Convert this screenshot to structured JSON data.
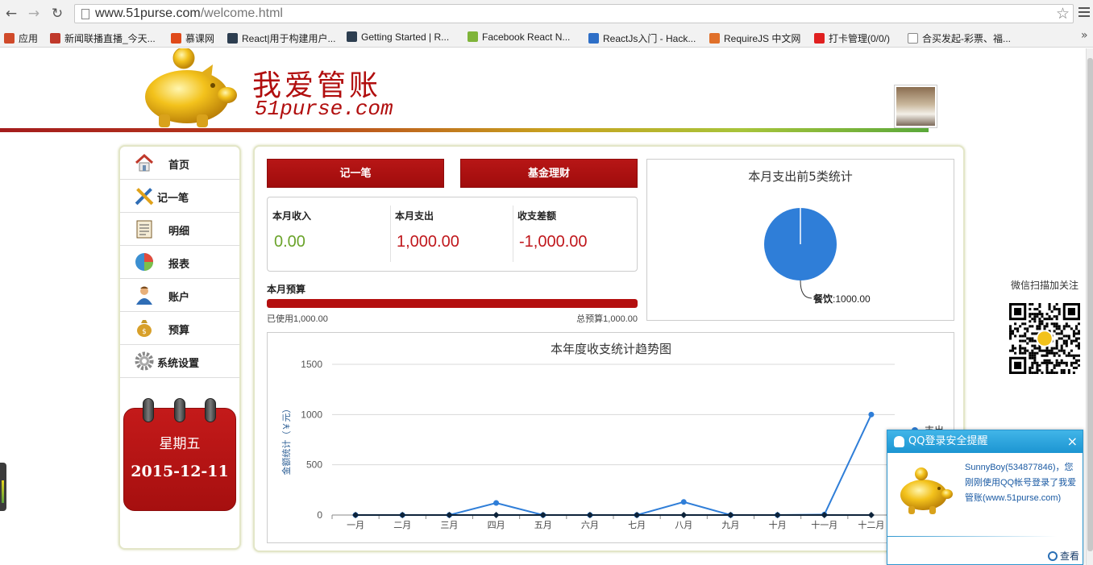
{
  "browser": {
    "url_host": "www.51purse.com",
    "url_path": "/welcome.html",
    "bookmarks": [
      {
        "label": "应用",
        "icon": "apps-grid-icon",
        "color": "#d04a2a"
      },
      {
        "label": "新闻联播直播_今天...",
        "icon": "news-icon",
        "color": "#c0392b"
      },
      {
        "label": "慕课网",
        "icon": "flame-icon",
        "color": "#e04a1a"
      },
      {
        "label": "React|用于构建用户...",
        "icon": "react-icon",
        "color": "#2d3e50"
      },
      {
        "label": "Getting Started | R...",
        "icon": "react-icon",
        "color": "#2d3e50"
      },
      {
        "label": "Facebook React N...",
        "icon": "leaf-icon",
        "color": "#7fb43a"
      },
      {
        "label": "ReactJs入门 - Hack...",
        "icon": "hack-icon",
        "color": "#2e6fc7"
      },
      {
        "label": "RequireJS 中文网",
        "icon": "requirejs-icon",
        "color": "#e0702a"
      },
      {
        "label": "打卡管理(0/0/)",
        "icon": "ok-icon",
        "color": "#e02020"
      },
      {
        "label": "合买发起-彩票、福...",
        "icon": "page-icon",
        "color": "#ffffff"
      }
    ]
  },
  "header": {
    "logo_title": "我爱管账",
    "logo_sub": "51purse.com"
  },
  "sidebar": {
    "items": [
      {
        "label": "首页",
        "icon": "home-icon"
      },
      {
        "label": "记一笔",
        "icon": "pencil-ruler-icon"
      },
      {
        "label": "明细",
        "icon": "list-icon"
      },
      {
        "label": "报表",
        "icon": "pie-icon"
      },
      {
        "label": "账户",
        "icon": "user-icon"
      },
      {
        "label": "预算",
        "icon": "money-bag-icon"
      },
      {
        "label": "系统设置",
        "icon": "gear-icon"
      }
    ],
    "calendar": {
      "weekday": "星期五",
      "date": "2015-12-11"
    }
  },
  "main": {
    "btn_record": "记一笔",
    "btn_fund": "基金理财",
    "summary": [
      {
        "label": "本月收入",
        "value": "0.00",
        "color": "#6aa32a"
      },
      {
        "label": "本月支出",
        "value": "1,000.00",
        "color": "#c0171c"
      },
      {
        "label": "收支差额",
        "value": "-1,000.00",
        "color": "#c0171c"
      }
    ],
    "budget": {
      "label": "本月预算",
      "used": "已使用1,000.00",
      "total": "总预算1,000.00",
      "fraction": 1.0
    }
  },
  "chart_data": [
    {
      "type": "pie",
      "title": "本月支出前5类统计",
      "slices": [
        {
          "name": "餐饮",
          "value": 1000.0,
          "label": ":1000.00",
          "color": "#2f7ed8"
        }
      ]
    },
    {
      "type": "line",
      "title": "本年度收支统计趋势图",
      "ylabel": "金额统计（￥元）",
      "ylim": [
        0,
        1500
      ],
      "yticks": [
        0,
        500,
        1000,
        1500
      ],
      "categories": [
        "一月",
        "二月",
        "三月",
        "四月",
        "五月",
        "六月",
        "七月",
        "八月",
        "九月",
        "十月",
        "十一月",
        "十二月"
      ],
      "series": [
        {
          "name": "支出",
          "color": "#2f7ed8",
          "values": [
            0,
            0,
            0,
            120,
            0,
            0,
            0,
            130,
            0,
            0,
            5,
            1000
          ]
        },
        {
          "name": "",
          "color": "#0d233a",
          "values": [
            0,
            0,
            0,
            0,
            0,
            0,
            0,
            0,
            0,
            0,
            0,
            0
          ]
        }
      ],
      "grid": true,
      "legend": "right"
    }
  ],
  "qr": {
    "label": "微信扫描加关注"
  },
  "qq_popup": {
    "title": "QQ登录安全提醒",
    "close": "×",
    "message": "SunnyBoy(534877846)，您刚刚使用QQ帐号登录了我爱管账(www.51purse.com)",
    "view": "查看"
  }
}
